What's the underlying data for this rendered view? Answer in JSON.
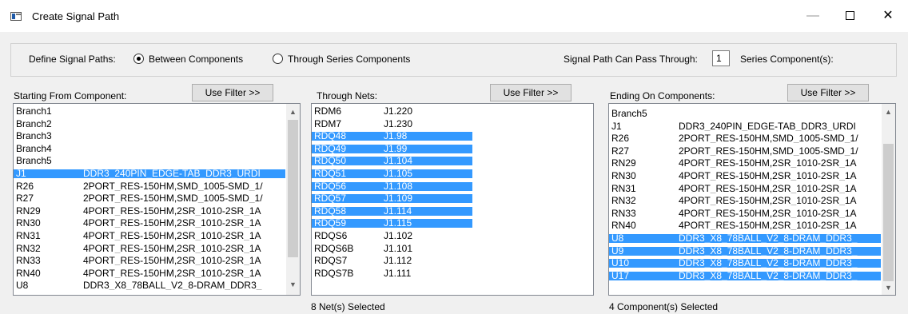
{
  "window": {
    "title": "Create Signal Path",
    "minimize_glyph": "—",
    "close_glyph": "✕"
  },
  "options": {
    "define_label": "Define Signal Paths:",
    "radio_between": "Between Components",
    "radio_through": "Through Series Components",
    "selected_mode": "Between Components",
    "pass_label": "Signal Path Can Pass Through:",
    "pass_value": "1",
    "pass_suffix": "Series Component(s):"
  },
  "starting": {
    "label": "Starting From Component:",
    "filter_button": "Use Filter >>",
    "rows": [
      {
        "name": "Branch1",
        "desc": "",
        "selected": false
      },
      {
        "name": "Branch2",
        "desc": "",
        "selected": false
      },
      {
        "name": "Branch3",
        "desc": "",
        "selected": false
      },
      {
        "name": "Branch4",
        "desc": "",
        "selected": false
      },
      {
        "name": "Branch5",
        "desc": "",
        "selected": false
      },
      {
        "name": "J1",
        "desc": "DDR3_240PIN_EDGE-TAB_DDR3_URDI",
        "selected": true
      },
      {
        "name": "R26",
        "desc": "2PORT_RES-150HM,SMD_1005-SMD_1/",
        "selected": false
      },
      {
        "name": "R27",
        "desc": "2PORT_RES-150HM,SMD_1005-SMD_1/",
        "selected": false
      },
      {
        "name": "RN29",
        "desc": "4PORT_RES-150HM,2SR_1010-2SR_1A",
        "selected": false
      },
      {
        "name": "RN30",
        "desc": "4PORT_RES-150HM,2SR_1010-2SR_1A",
        "selected": false
      },
      {
        "name": "RN31",
        "desc": "4PORT_RES-150HM,2SR_1010-2SR_1A",
        "selected": false
      },
      {
        "name": "RN32",
        "desc": "4PORT_RES-150HM,2SR_1010-2SR_1A",
        "selected": false
      },
      {
        "name": "RN33",
        "desc": "4PORT_RES-150HM,2SR_1010-2SR_1A",
        "selected": false
      },
      {
        "name": "RN40",
        "desc": "4PORT_RES-150HM,2SR_1010-2SR_1A",
        "selected": false
      },
      {
        "name": "U8",
        "desc": "DDR3_X8_78BALL_V2_8-DRAM_DDR3_",
        "selected": false
      }
    ]
  },
  "through": {
    "label": "Through Nets:",
    "filter_button": "Use Filter >>",
    "status": "8 Net(s) Selected",
    "rows": [
      {
        "name": "RDM6",
        "pin": "J1.220",
        "selected": false
      },
      {
        "name": "RDM7",
        "pin": "J1.230",
        "selected": false
      },
      {
        "name": "RDQ48",
        "pin": "J1.98",
        "selected": true
      },
      {
        "name": "RDQ49",
        "pin": "J1.99",
        "selected": true
      },
      {
        "name": "RDQ50",
        "pin": "J1.104",
        "selected": true
      },
      {
        "name": "RDQ51",
        "pin": "J1.105",
        "selected": true
      },
      {
        "name": "RDQ56",
        "pin": "J1.108",
        "selected": true
      },
      {
        "name": "RDQ57",
        "pin": "J1.109",
        "selected": true
      },
      {
        "name": "RDQ58",
        "pin": "J1.114",
        "selected": true
      },
      {
        "name": "RDQ59",
        "pin": "J1.115",
        "selected": true
      },
      {
        "name": "RDQS6",
        "pin": "J1.102",
        "selected": false
      },
      {
        "name": "RDQS6B",
        "pin": "J1.101",
        "selected": false
      },
      {
        "name": "RDQS7",
        "pin": "J1.112",
        "selected": false
      },
      {
        "name": "RDQS7B",
        "pin": "J1.111",
        "selected": false
      }
    ]
  },
  "ending": {
    "label": "Ending On Components:",
    "filter_button": "Use Filter >>",
    "status": "4 Component(s) Selected",
    "rows": [
      {
        "name": "Branch5",
        "desc": "",
        "selected": false
      },
      {
        "name": "J1",
        "desc": "DDR3_240PIN_EDGE-TAB_DDR3_URDI",
        "selected": false
      },
      {
        "name": "R26",
        "desc": "2PORT_RES-150HM,SMD_1005-SMD_1/",
        "selected": false
      },
      {
        "name": "R27",
        "desc": "2PORT_RES-150HM,SMD_1005-SMD_1/",
        "selected": false
      },
      {
        "name": "RN29",
        "desc": "4PORT_RES-150HM,2SR_1010-2SR_1A",
        "selected": false
      },
      {
        "name": "RN30",
        "desc": "4PORT_RES-150HM,2SR_1010-2SR_1A",
        "selected": false
      },
      {
        "name": "RN31",
        "desc": "4PORT_RES-150HM,2SR_1010-2SR_1A",
        "selected": false
      },
      {
        "name": "RN32",
        "desc": "4PORT_RES-150HM,2SR_1010-2SR_1A",
        "selected": false
      },
      {
        "name": "RN33",
        "desc": "4PORT_RES-150HM,2SR_1010-2SR_1A",
        "selected": false
      },
      {
        "name": "RN40",
        "desc": "4PORT_RES-150HM,2SR_1010-2SR_1A",
        "selected": false
      },
      {
        "name": "U8",
        "desc": "DDR3_X8_78BALL_V2_8-DRAM_DDR3_",
        "selected": true
      },
      {
        "name": "U9",
        "desc": "DDR3_X8_78BALL_V2_8-DRAM_DDR3_",
        "selected": true
      },
      {
        "name": "U10",
        "desc": "DDR3_X8_78BALL_V2_8-DRAM_DDR3_",
        "selected": true
      },
      {
        "name": "U17",
        "desc": "DDR3_X8_78BALL_V2_8-DRAM_DDR3_",
        "selected": true
      }
    ]
  },
  "colors": {
    "selection": "#3399ff",
    "window_bg": "#f0f0f0"
  }
}
